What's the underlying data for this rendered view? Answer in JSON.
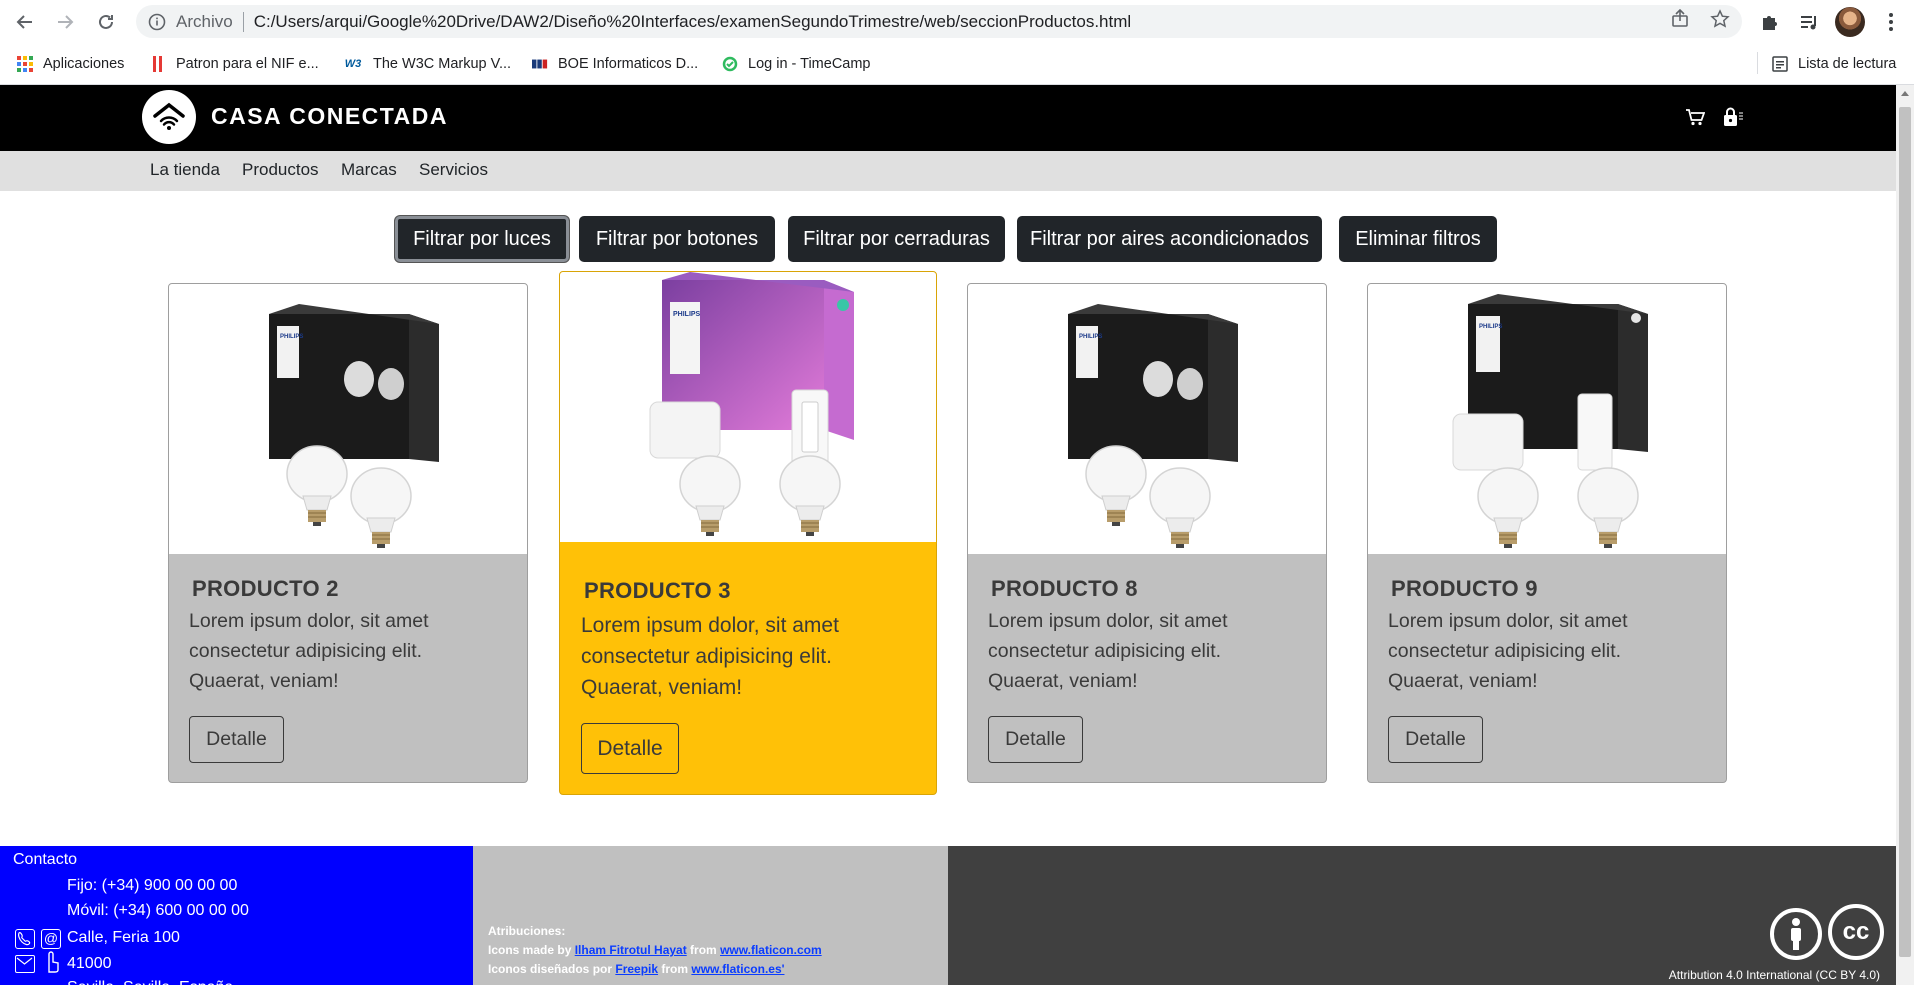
{
  "browser": {
    "scheme_label": "Archivo",
    "url": "C:/Users/arqui/Google%20Drive/DAW2/Diseño%20Interfaces/examenSegundoTrimestre/web/seccionProductos.html",
    "bookmarks": [
      {
        "label": "Aplicaciones",
        "icon": "apps-grid-icon"
      },
      {
        "label": "Patron para el NIF e...",
        "icon": "bookmark-red-icon"
      },
      {
        "label": "The W3C Markup V...",
        "icon": "w3c-icon"
      },
      {
        "label": "BOE Informaticos D...",
        "icon": "boe-icon"
      },
      {
        "label": "Log in - TimeCamp",
        "icon": "timecamp-icon"
      }
    ],
    "reading_list": "Lista de lectura"
  },
  "site": {
    "brand": "CASA CONECTADA",
    "nav": [
      "La tienda",
      "Productos",
      "Marcas",
      "Servicios"
    ]
  },
  "filters": [
    {
      "label": "Filtrar por luces",
      "active": true
    },
    {
      "label": "Filtrar por botones",
      "active": false
    },
    {
      "label": "Filtrar por cerraduras",
      "active": false
    },
    {
      "label": "Filtrar por aires acondicionados",
      "active": false
    },
    {
      "label": "Eliminar filtros",
      "active": false
    }
  ],
  "products": [
    {
      "title": "PRODUCTO 2",
      "line1": "Lorem ipsum dolor, sit amet",
      "line2": "consectetur adipisicing elit.",
      "line3": "Quaerat, veniam!",
      "button": "Detalle",
      "featured": false,
      "image": "lamp-kit-dark-box"
    },
    {
      "title": "PRODUCTO 3",
      "line1": "Lorem ipsum dolor, sit amet",
      "line2": "consectetur adipisicing elit.",
      "line3": "Quaerat, veniam!",
      "button": "Detalle",
      "featured": true,
      "image": "lamp-kit-color-box"
    },
    {
      "title": "PRODUCTO 8",
      "line1": "Lorem ipsum dolor, sit amet",
      "line2": "consectetur adipisicing elit.",
      "line3": "Quaerat, veniam!",
      "button": "Detalle",
      "featured": false,
      "image": "lamp-kit-dark-box"
    },
    {
      "title": "PRODUCTO 9",
      "line1": "Lorem ipsum dolor, sit amet",
      "line2": "consectetur adipisicing elit.",
      "line3": "Quaerat, veniam!",
      "button": "Detalle",
      "featured": false,
      "image": "lamp-kit-dark-box-bridge"
    }
  ],
  "footer": {
    "contact_title": "Contacto",
    "phone_fixed": "Fijo: (+34) 900 00 00 00",
    "phone_mobile": "Móvil: (+34) 600 00 00 00",
    "address": "Calle, Feria 100",
    "postcode": "41000",
    "city": "Sevilla, Sevilla, España",
    "attr_title": "Atribuciones:",
    "attr1_prefix": "Icons made by ",
    "attr1_author": "Ilham Fitrotul Hayat",
    "attr1_mid": " from ",
    "attr1_site": "www.flaticon.com",
    "attr2_prefix": "Iconos diseñados por ",
    "attr2_author": "Freepik",
    "attr2_mid": " from ",
    "attr2_site": "www.flaticon.es'",
    "license": "Attribution 4.0 International (CC BY 4.0)"
  },
  "colors": {
    "header": "#000000",
    "nav": "#e0e0e0",
    "card": "#c0c0c0",
    "featured": "#ffc107",
    "footer_blue": "#0000ff",
    "footer_dark": "#404040"
  }
}
